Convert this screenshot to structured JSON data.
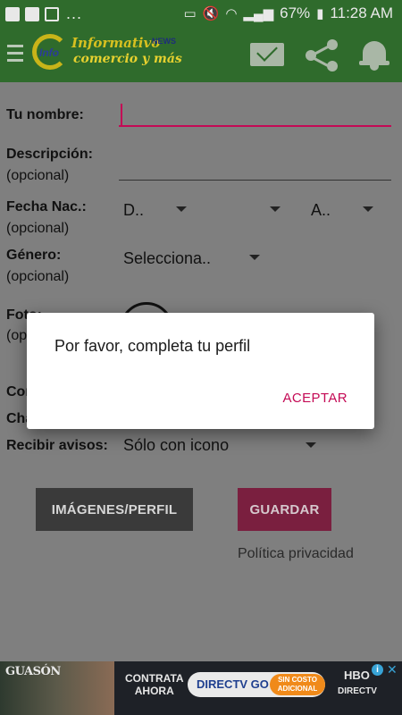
{
  "status_bar": {
    "dots": "...",
    "battery": "67%",
    "time": "11:28 AM"
  },
  "app_bar": {
    "logo_info": "Info",
    "logo_line1": "Informativo",
    "logo_news": "NEWS",
    "logo_line2": "comercio y más",
    "icons": [
      "menu-icon",
      "mail-icon",
      "share-icon",
      "bell-icon"
    ]
  },
  "form": {
    "name_label": "Tu nombre:",
    "name_value": "",
    "desc_label": "Descripción:",
    "desc_sub": "(opcional)",
    "desc_value": "",
    "birth_label": "Fecha Nac.:",
    "birth_sub": "(opcional)",
    "birth_day": "D..",
    "birth_year": "A..",
    "gender_label": "Género:",
    "gender_sub": "(opcional)",
    "gender_value": "Selecciona..",
    "photo_label": "Foto:",
    "photo_sub": "(op",
    "row_con": "Con",
    "row_cha": "Cha",
    "notify_label": "Recibir avisos:",
    "notify_value": "Sólo con icono",
    "btn_images": "IMÁGENES/PERFIL",
    "btn_save": "GUARDAR",
    "privacy": "Política privacidad"
  },
  "dialog": {
    "message": "Por favor, completa tu perfil",
    "accept": "ACEPTAR"
  },
  "ad": {
    "title": "GUASÓN",
    "contrata": "CONTRATA",
    "ahora": "AHORA",
    "directv_go": "DIRECTV GO",
    "costo": "SIN COSTO ADICIONAL",
    "hbo": "HBO",
    "directv": "DIRECTV"
  },
  "colors": {
    "app_green": "#2f6b2c",
    "accent": "#c40a55",
    "overlay_bg": "#7f7f7f"
  }
}
